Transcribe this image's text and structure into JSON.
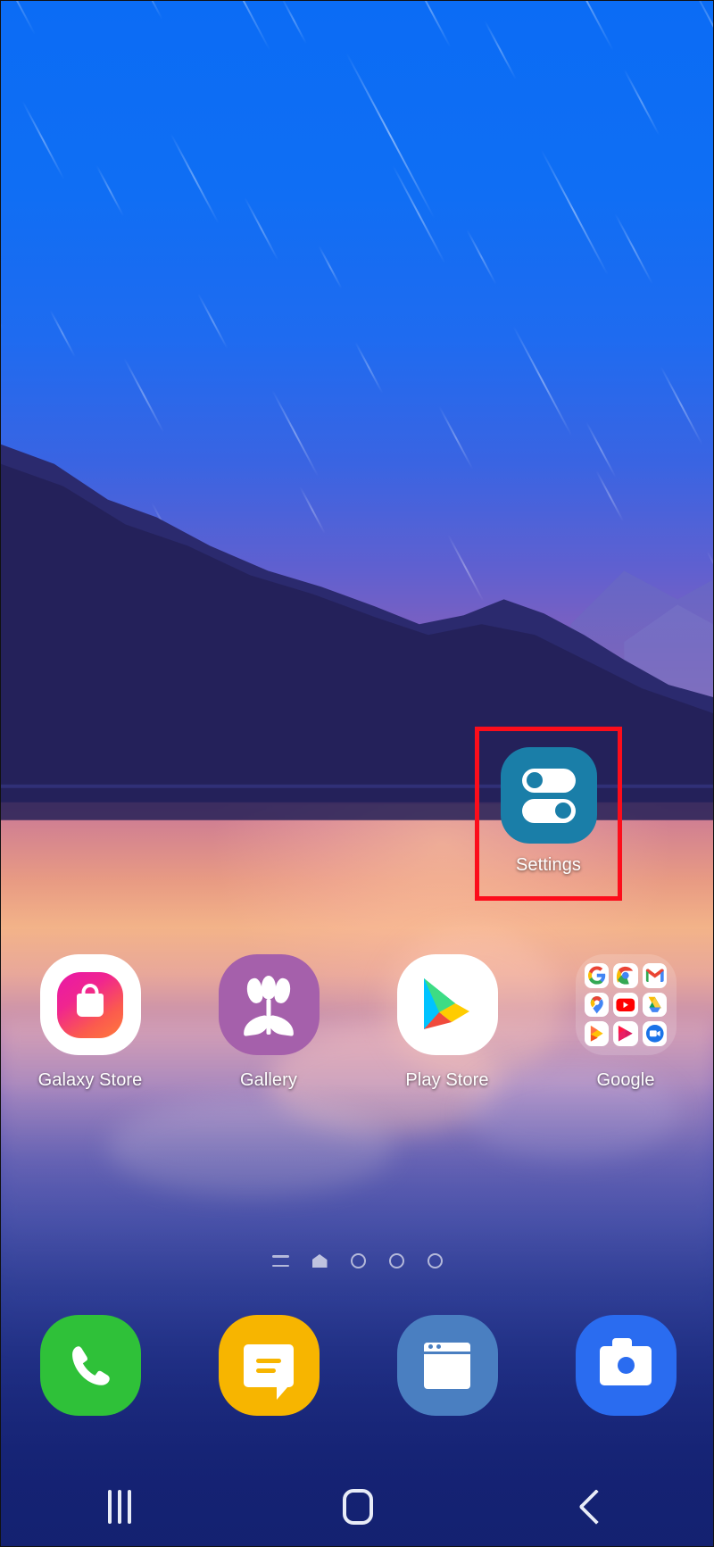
{
  "device": {
    "platform": "Android",
    "screen": "home-screen"
  },
  "highlight": {
    "color": "#fc0d1b",
    "target": "Settings"
  },
  "settings_app": {
    "label": "Settings",
    "icon": "settings-toggles-icon",
    "icon_color": "#1a7ea8"
  },
  "app_row": [
    {
      "label": "Galaxy Store",
      "icon": "galaxy-store-icon",
      "color": "#ffffff"
    },
    {
      "label": "Gallery",
      "icon": "gallery-tulip-icon",
      "color": "#a560ab"
    },
    {
      "label": "Play Store",
      "icon": "play-store-icon",
      "color": "#ffffff"
    },
    {
      "label": "Google",
      "icon": "google-folder-icon",
      "color": "#ffffff29"
    }
  ],
  "google_folder": {
    "label": "Google",
    "apps": [
      {
        "name": "Google",
        "icon": "google-g-icon"
      },
      {
        "name": "Chrome",
        "icon": "chrome-icon"
      },
      {
        "name": "Gmail",
        "icon": "gmail-m-icon"
      },
      {
        "name": "Maps",
        "icon": "maps-pin-icon"
      },
      {
        "name": "YouTube",
        "icon": "youtube-icon"
      },
      {
        "name": "Drive",
        "icon": "drive-triangle-icon"
      },
      {
        "name": "Google TV",
        "icon": "play-movies-icon"
      },
      {
        "name": "YT Music",
        "icon": "youtube-music-icon"
      },
      {
        "name": "Meet",
        "icon": "meet-video-icon"
      }
    ]
  },
  "page_indicator": {
    "items": [
      "apps-list-icon",
      "home-page-icon",
      "page-dot",
      "page-dot",
      "page-dot"
    ],
    "active_index": 1,
    "total_pages": 5
  },
  "dock": [
    {
      "label": "Phone",
      "icon": "phone-icon",
      "color": "#2fc139"
    },
    {
      "label": "Messages",
      "icon": "message-icon",
      "color": "#f7b500"
    },
    {
      "label": "Internet",
      "icon": "browser-icon",
      "color": "#4a7fc1"
    },
    {
      "label": "Camera",
      "icon": "camera-icon",
      "color": "#2a6cf0"
    }
  ],
  "nav_bar": [
    {
      "name": "Recents",
      "icon": "recents-icon"
    },
    {
      "name": "Home",
      "icon": "home-icon"
    },
    {
      "name": "Back",
      "icon": "back-icon"
    }
  ]
}
